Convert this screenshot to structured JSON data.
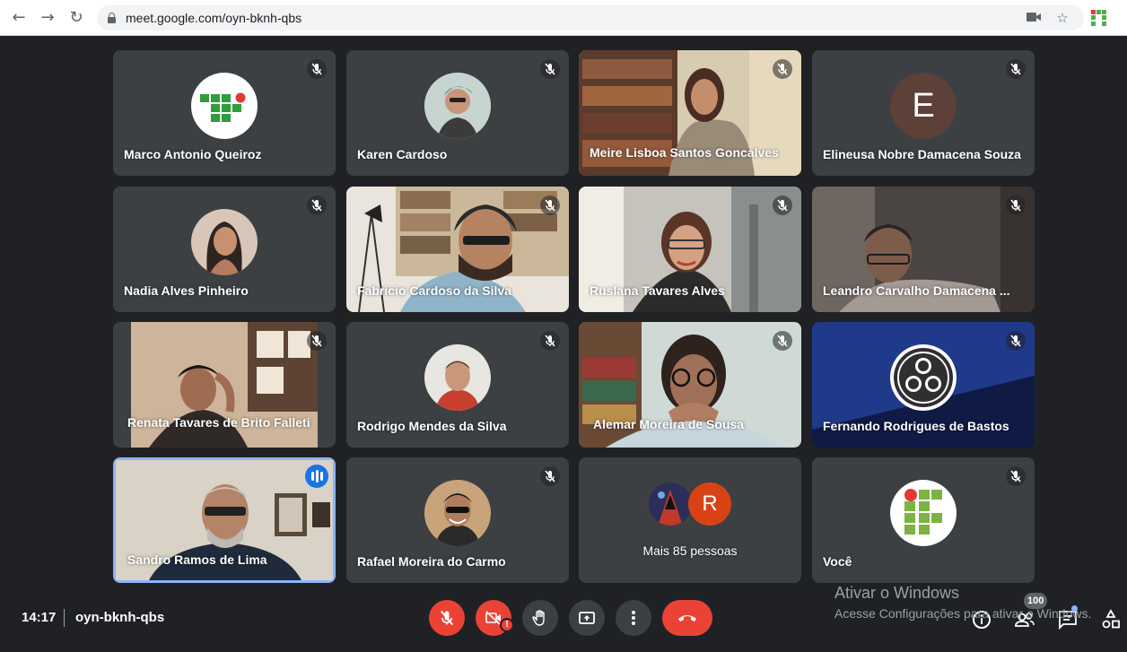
{
  "browser": {
    "url": "meet.google.com/oyn-bknh-qbs",
    "back_icon": "arrow-left-icon",
    "forward_icon": "arrow-right-icon",
    "reload_icon": "reload-icon"
  },
  "participants": [
    {
      "name": "Marco Antonio Queiroz",
      "muted": true,
      "tile": "logo"
    },
    {
      "name": "Karen Cardoso",
      "muted": true,
      "tile": "avatar"
    },
    {
      "name": "Meire Lisboa Santos Goncalves",
      "muted": true,
      "tile": "video"
    },
    {
      "name": "Elineusa Nobre Damacena Souza",
      "muted": true,
      "tile": "letter",
      "initial": "E"
    },
    {
      "name": "Nadia Alves Pinheiro",
      "muted": true,
      "tile": "avatar"
    },
    {
      "name": "Fabricio Cardoso da Silva",
      "muted": true,
      "tile": "video"
    },
    {
      "name": "Ruslana Tavares Alves",
      "muted": true,
      "tile": "video"
    },
    {
      "name": "Leandro Carvalho Damacena ...",
      "muted": true,
      "tile": "video"
    },
    {
      "name": "Renata Tavares de Brito Falleti",
      "muted": true,
      "tile": "video"
    },
    {
      "name": "Rodrigo Mendes da Silva",
      "muted": true,
      "tile": "avatar"
    },
    {
      "name": "Alemar Moreira de Sousa",
      "muted": true,
      "tile": "video"
    },
    {
      "name": "Fernando Rodrigues de Bastos",
      "muted": true,
      "tile": "obs"
    },
    {
      "name": "Sandro Ramos de Lima",
      "muted": false,
      "speaking": true,
      "tile": "video"
    },
    {
      "name": "Rafael Moreira do Carmo",
      "muted": true,
      "tile": "avatar"
    },
    {
      "name": "Mais 85 pessoas",
      "muted": false,
      "tile": "more",
      "initial": "R"
    },
    {
      "name": "Você",
      "muted": true,
      "tile": "logo"
    }
  ],
  "bottom_bar": {
    "time": "14:17",
    "meeting_code": "oyn-bknh-qbs",
    "camera_warning": "!",
    "people_count": "100"
  },
  "watermark": {
    "title": "Ativar o Windows",
    "subtitle": "Acesse Configurações para ativar o Windows."
  },
  "colors": {
    "background": "#202124",
    "tile": "#3c4043",
    "danger": "#ea4335",
    "speaking": "#1a73e8"
  }
}
